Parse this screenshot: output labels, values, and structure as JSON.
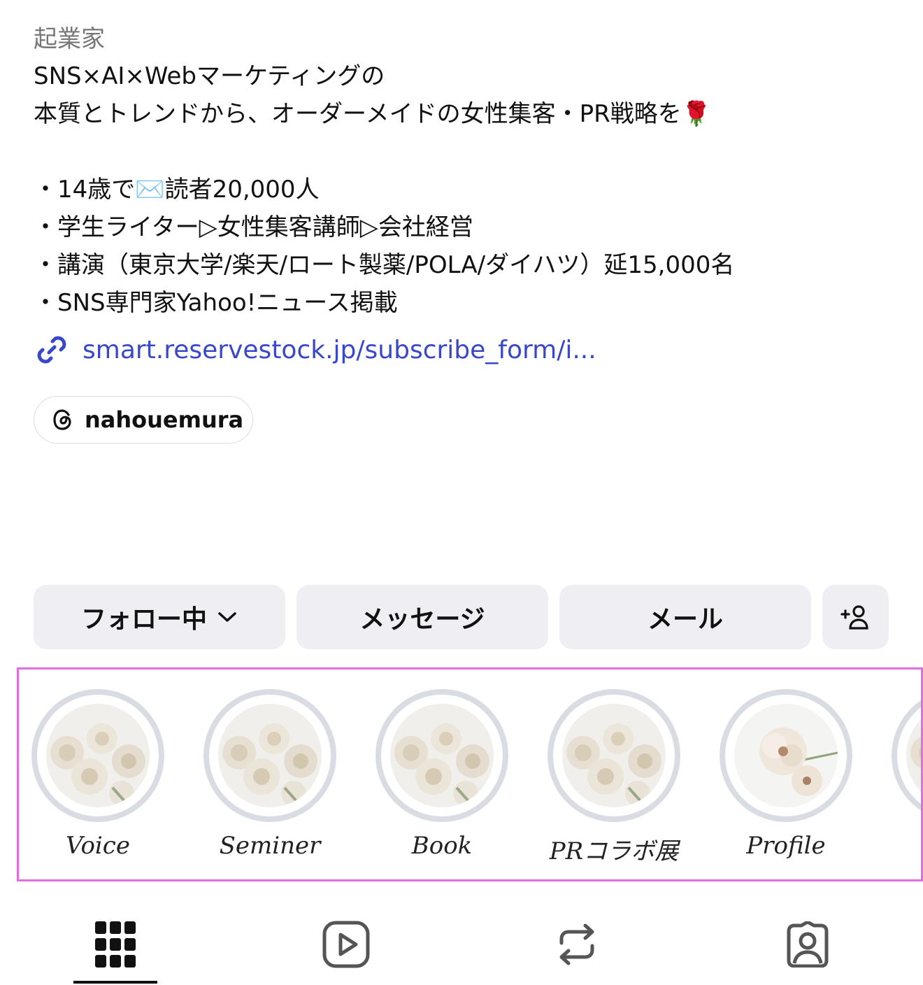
{
  "profile": {
    "category": "起業家",
    "bio": {
      "line1": "SNS×AI×Webマーケティングの",
      "line2": "本質とトレンドから、オーダーメイドの女性集客・PR戦略を🌹",
      "line3": "・14歳で✉️読者20,000人",
      "line4": "・学生ライター▷女性集客講師▷会社経営",
      "line5": "・講演（東京大学/楽天/ロート製薬/POLA/ダイハツ）延15,000名",
      "line6": "・SNS専門家Yahoo!ニュース掲載"
    },
    "link": {
      "text": "smart.reservestock.jp/subscribe_form/i...",
      "icon": "link-icon"
    },
    "threads": {
      "handle": "nahouemura",
      "icon": "threads-icon"
    }
  },
  "actions": {
    "following_label": "フォロー中",
    "message_label": "メッセージ",
    "mail_label": "メール",
    "add_user_icon": "add-person-icon"
  },
  "highlights": [
    {
      "label": "Voice"
    },
    {
      "label": "Seminer"
    },
    {
      "label": "Book"
    },
    {
      "label": "PRコラボ展"
    },
    {
      "label": "Profile"
    }
  ],
  "tabs": [
    {
      "icon": "grid-icon",
      "active": true
    },
    {
      "icon": "reels-icon",
      "active": false
    },
    {
      "icon": "repost-icon",
      "active": false
    },
    {
      "icon": "tagged-icon",
      "active": false
    }
  ],
  "colors": {
    "link": "#3848c8",
    "highlight_frame": "#e56ce0",
    "button_bg": "#efeff3"
  }
}
